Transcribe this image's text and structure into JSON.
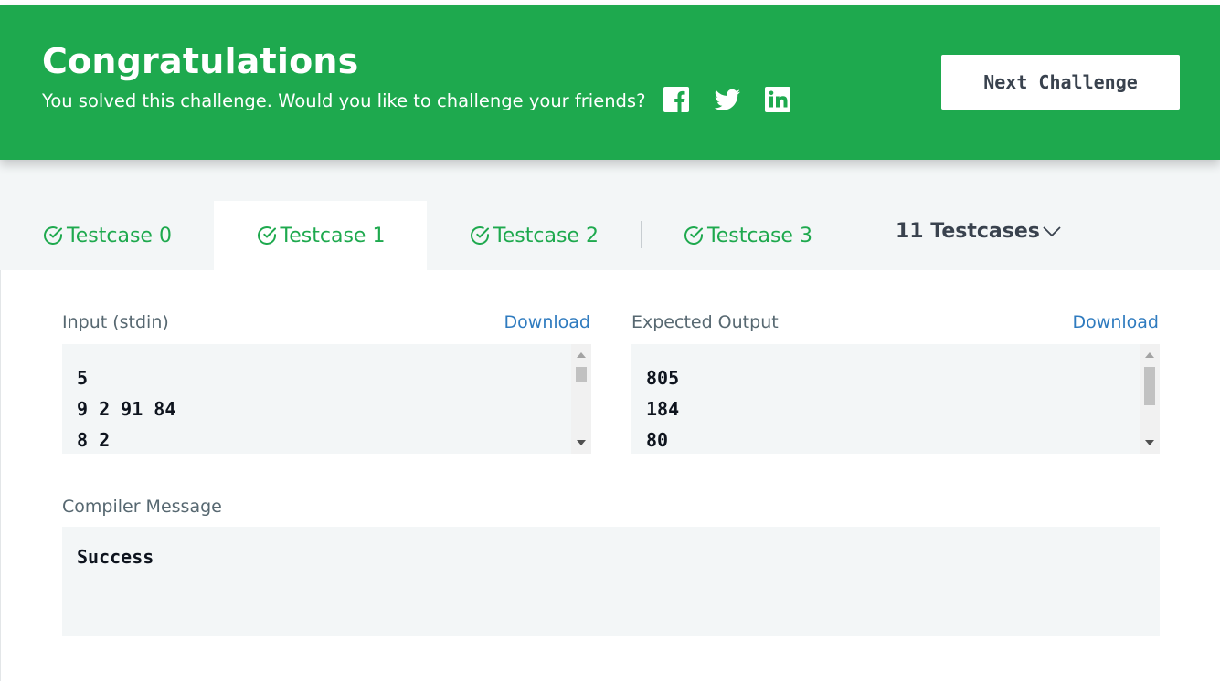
{
  "banner": {
    "title": "Congratulations",
    "subtitle": "You solved this challenge. Would you like to challenge your friends?",
    "share_icons": [
      "facebook-icon",
      "twitter-icon",
      "linkedin-icon"
    ],
    "next_button": "Next Challenge",
    "color": "#1ea94e"
  },
  "tabs": {
    "items": [
      {
        "label": "Testcase 0",
        "icon": "check-circle-icon",
        "active": false
      },
      {
        "label": "Testcase 1",
        "icon": "check-circle-icon",
        "active": true
      },
      {
        "label": "Testcase 2",
        "icon": "check-circle-icon",
        "active": false
      },
      {
        "label": "Testcase 3",
        "icon": "check-circle-icon",
        "active": false
      }
    ],
    "more_label": "11 Testcases",
    "more_icon": "chevron-down-icon",
    "accent": "#1ea94e"
  },
  "input": {
    "label": "Input (stdin)",
    "download": "Download",
    "lines": [
      "5",
      "9 2 91 84",
      "8 2"
    ]
  },
  "expected": {
    "label": "Expected Output",
    "download": "Download",
    "lines": [
      "805",
      "184",
      "80"
    ]
  },
  "compiler": {
    "label": "Compiler Message",
    "message": "Success"
  },
  "colors": {
    "link": "#2f7bbf",
    "panel_bg": "#f3f6f7",
    "text_dark": "#0e141e",
    "label_gray": "#576871"
  }
}
